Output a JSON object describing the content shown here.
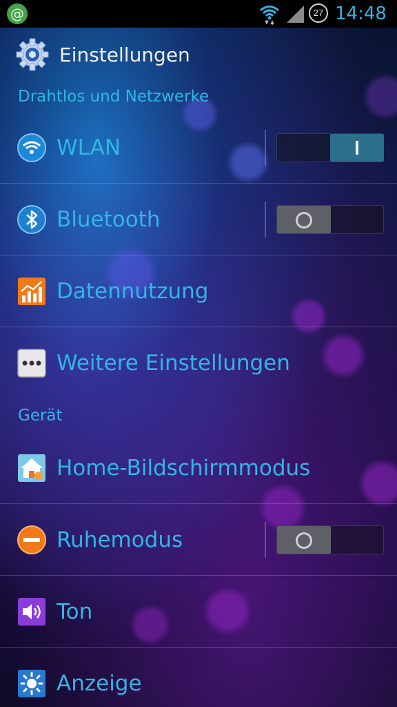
{
  "status_bar": {
    "time": "14:48",
    "battery_level": "27",
    "icons": [
      "email-icon",
      "wifi-icon",
      "signal-icon",
      "battery-icon"
    ]
  },
  "action_bar": {
    "title": "Einstellungen",
    "icon": "settings-gear-icon"
  },
  "sections": {
    "wireless": {
      "header": "Drahtlos und Netzwerke",
      "items": [
        {
          "label": "WLAN",
          "icon": "wifi-icon",
          "toggle": "on"
        },
        {
          "label": "Bluetooth",
          "icon": "bluetooth-icon",
          "toggle": "off"
        },
        {
          "label": "Datennutzung",
          "icon": "data-usage-icon"
        },
        {
          "label": "Weitere Einstellungen",
          "icon": "more-icon"
        }
      ]
    },
    "device": {
      "header": "Gerät",
      "items": [
        {
          "label": "Home-Bildschirmmodus",
          "icon": "home-screen-icon"
        },
        {
          "label": "Ruhemodus",
          "icon": "blocking-mode-icon",
          "toggle": "off"
        },
        {
          "label": "Ton",
          "icon": "sound-icon"
        },
        {
          "label": "Anzeige",
          "icon": "display-icon"
        }
      ]
    }
  },
  "colors": {
    "accent": "#33b5e5",
    "switch_on": "#2c6f8d",
    "switch_off": "#5d6167",
    "status_email": "#47a24a"
  }
}
